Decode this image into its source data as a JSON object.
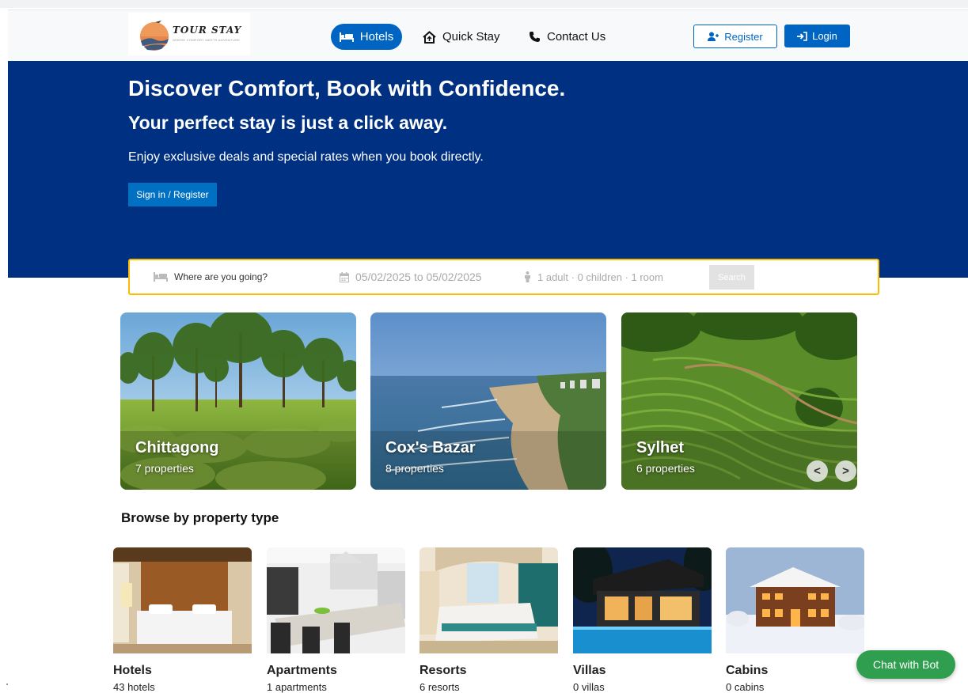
{
  "brand": {
    "name": "TOUR STAY",
    "tagline": "WHERE COMFORT MEETS ADVENTURE"
  },
  "nav": {
    "items": [
      {
        "label": "Hotels",
        "icon": "bed-icon",
        "active": true
      },
      {
        "label": "Quick Stay",
        "icon": "house-icon"
      },
      {
        "label": "Contact Us",
        "icon": "phone-icon"
      }
    ],
    "register_label": "Register",
    "login_label": "Login"
  },
  "hero": {
    "title": "Discover Comfort, Book with Confidence.",
    "subtitle": "Your perfect stay is just a click away.",
    "text": "Enjoy exclusive deals and special rates when you book directly.",
    "button_label": "Sign in / Register"
  },
  "search": {
    "destination_placeholder": "Where are you going?",
    "dates": "05/02/2025 to 05/02/2025",
    "guests": "1 adult · 0 children · 1 room",
    "button_label": "Search"
  },
  "cities": [
    {
      "name": "Chittagong",
      "count": "7 properties"
    },
    {
      "name": "Cox's Bazar",
      "count": "8 properties"
    },
    {
      "name": "Sylhet",
      "count": "6 properties"
    }
  ],
  "carousel": {
    "prev_label": "<",
    "next_label": ">"
  },
  "browse": {
    "heading": "Browse by property type",
    "types": [
      {
        "name": "Hotels",
        "count": "43 hotels"
      },
      {
        "name": "Apartments",
        "count": "1 apartments"
      },
      {
        "name": "Resorts",
        "count": "6 resorts"
      },
      {
        "name": "Villas",
        "count": "0 villas"
      },
      {
        "name": "Cabins",
        "count": "0 cabins"
      }
    ]
  },
  "chat": {
    "label": "Chat with Bot"
  },
  "colors": {
    "primary": "#0065c2",
    "hero_bg": "#003081",
    "search_border": "#febb02",
    "chat_bg": "#2f9e4e"
  }
}
